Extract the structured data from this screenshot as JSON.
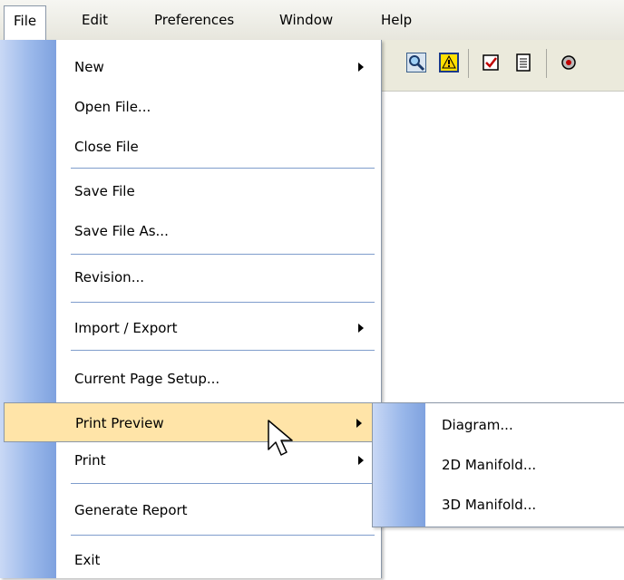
{
  "menubar": {
    "items": [
      {
        "label": "File"
      },
      {
        "label": "Edit"
      },
      {
        "label": "Preferences"
      },
      {
        "label": "Window"
      },
      {
        "label": "Help"
      }
    ]
  },
  "toolbar": {
    "icons": [
      "zoom-icon",
      "warning-icon",
      "checklist-icon",
      "document-icon",
      "gear-icon"
    ]
  },
  "file_menu": {
    "items": [
      {
        "label": "New",
        "submenu": true
      },
      {
        "label": "Open File..."
      },
      {
        "label": "Close File"
      },
      {
        "label": "Save File"
      },
      {
        "label": "Save File As..."
      },
      {
        "label": "Revision..."
      },
      {
        "label": "Import / Export",
        "submenu": true
      },
      {
        "label": "Current Page Setup..."
      },
      {
        "label": "Print Preview",
        "submenu": true,
        "highlighted": true
      },
      {
        "label": "Print",
        "submenu": true
      },
      {
        "label": "Generate Report"
      },
      {
        "label": "Exit"
      }
    ]
  },
  "print_preview_submenu": {
    "items": [
      {
        "label": "Diagram..."
      },
      {
        "label": "2D Manifold..."
      },
      {
        "label": "3D Manifold..."
      }
    ]
  },
  "colors": {
    "highlight": "#ffe4a8",
    "gutter": "#9ab8ea",
    "separator": "#7f9dcc"
  }
}
